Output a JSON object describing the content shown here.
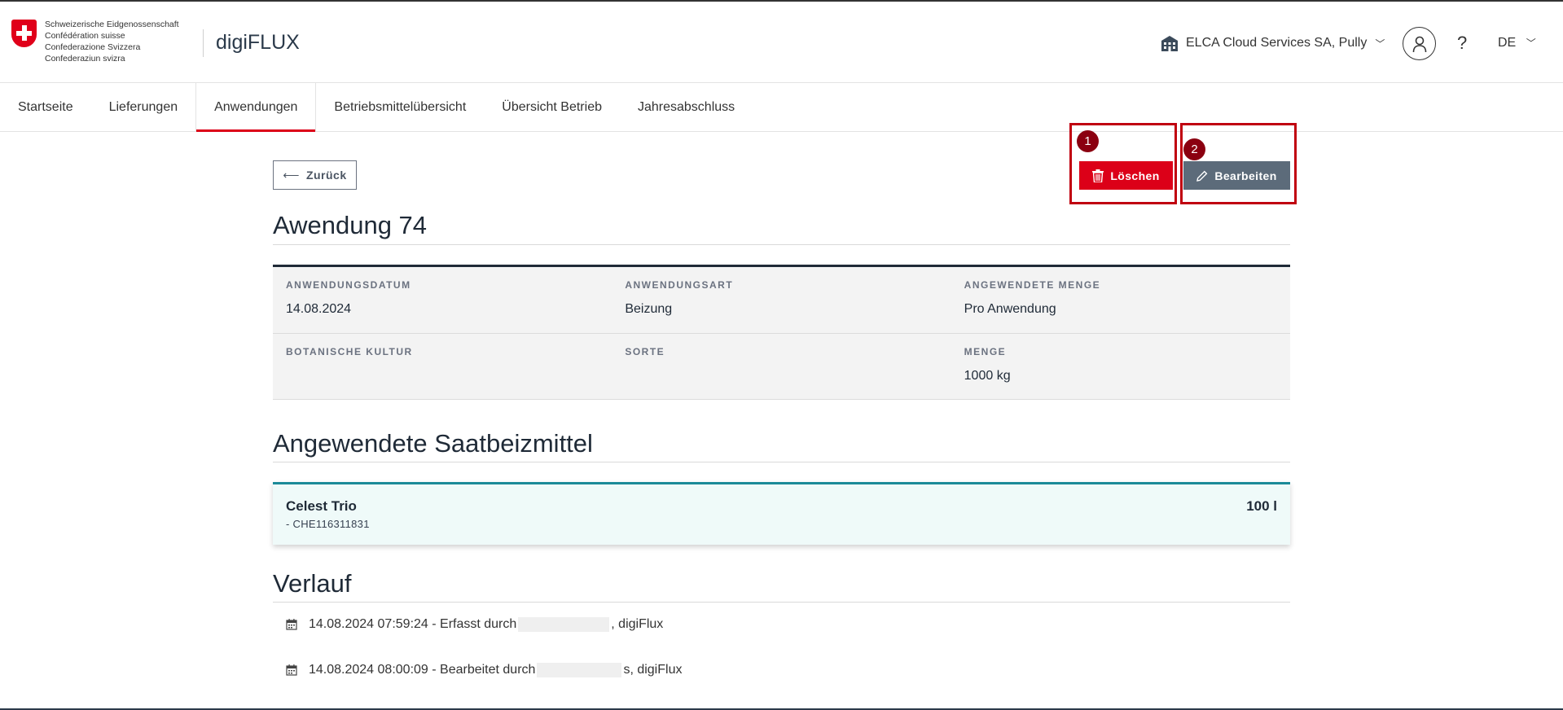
{
  "header": {
    "confederation_lines": [
      "Schweizerische Eidgenossenschaft",
      "Confédération suisse",
      "Confederazione Svizzera",
      "Confederaziun svizra"
    ],
    "app_title": "digiFLUX",
    "organization": "ELCA Cloud Services SA, Pully",
    "help_label": "?",
    "language": "DE",
    "icons": [
      "swiss-cross-icon",
      "building-icon",
      "chevron-down-icon",
      "user-icon"
    ]
  },
  "nav": {
    "items": [
      "Startseite",
      "Lieferungen",
      "Anwendungen",
      "Betriebsmittelübersicht",
      "Übersicht Betrieb",
      "Jahresabschluss"
    ],
    "active": "Anwendungen"
  },
  "actions": {
    "back_label": "Zurück",
    "delete_label": "Löschen",
    "edit_label": "Bearbeiten",
    "delete_color": "#dc0018",
    "edit_color": "#5c6b7a"
  },
  "annotations": {
    "badge1": "1",
    "badge2": "2",
    "highlight_color": "#c00010"
  },
  "page": {
    "title": "Awendung 74",
    "details": {
      "row1": [
        {
          "label": "ANWENDUNGSDATUM",
          "value": "14.08.2024"
        },
        {
          "label": "ANWENDUNGSART",
          "value": "Beizung"
        },
        {
          "label": "ANGEWENDETE MENGE",
          "value": "Pro Anwendung"
        }
      ],
      "row2": [
        {
          "label": "BOTANISCHE KULTUR",
          "value": ""
        },
        {
          "label": "SORTE",
          "value": ""
        },
        {
          "label": "MENGE",
          "value": "1000 kg"
        }
      ]
    },
    "products_title": "Angewendete Saatbeizmittel",
    "product": {
      "name": "Celest Trio",
      "code": "- CHE116311831",
      "amount": "100 l"
    },
    "history_title": "Verlauf",
    "history": [
      {
        "prefix": "14.08.2024 07:59:24 - Erfasst durch",
        "suffix": ", digiFlux"
      },
      {
        "prefix": "14.08.2024 08:00:09 - Bearbeitet durch",
        "suffix": "s, digiFlux"
      }
    ]
  }
}
